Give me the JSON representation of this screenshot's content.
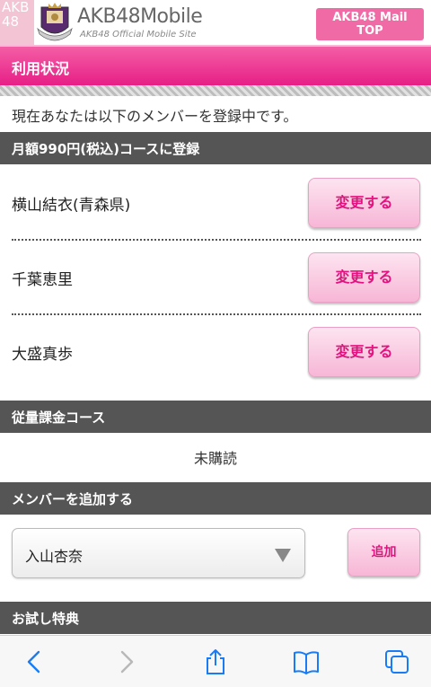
{
  "header": {
    "logo_lines": [
      "AKB",
      "48"
    ],
    "brand": "AKB48Mobile",
    "brand_sub": "AKB48 Official Mobile Site",
    "mail_button": [
      "AKB48 Mail",
      "TOP"
    ]
  },
  "page_title": "利用状況",
  "intro": "現在あなたは以下のメンバーを登録中です。",
  "monthly_section": {
    "title": "月額990円(税込)コースに登録",
    "members": [
      {
        "name": "横山結衣(青森県)",
        "button": "変更する"
      },
      {
        "name": "千葉恵里",
        "button": "変更する"
      },
      {
        "name": "大盛真歩",
        "button": "変更する"
      }
    ]
  },
  "pay_per_use_section": {
    "title": "従量課金コース",
    "status": "未購読"
  },
  "add_member_section": {
    "title": "メンバーを追加する",
    "selected": "入山杏奈",
    "add_button": "追加"
  },
  "trial_section": {
    "title": "お試し特典"
  },
  "toolbar": {
    "icons": [
      "back-icon",
      "forward-icon",
      "share-icon",
      "bookmarks-icon",
      "tabs-icon"
    ]
  },
  "colors": {
    "accent": "#e71f86",
    "section_bg": "#555555",
    "button_text": "#e2127e",
    "toolbar_icon": "#1a7cf5"
  }
}
